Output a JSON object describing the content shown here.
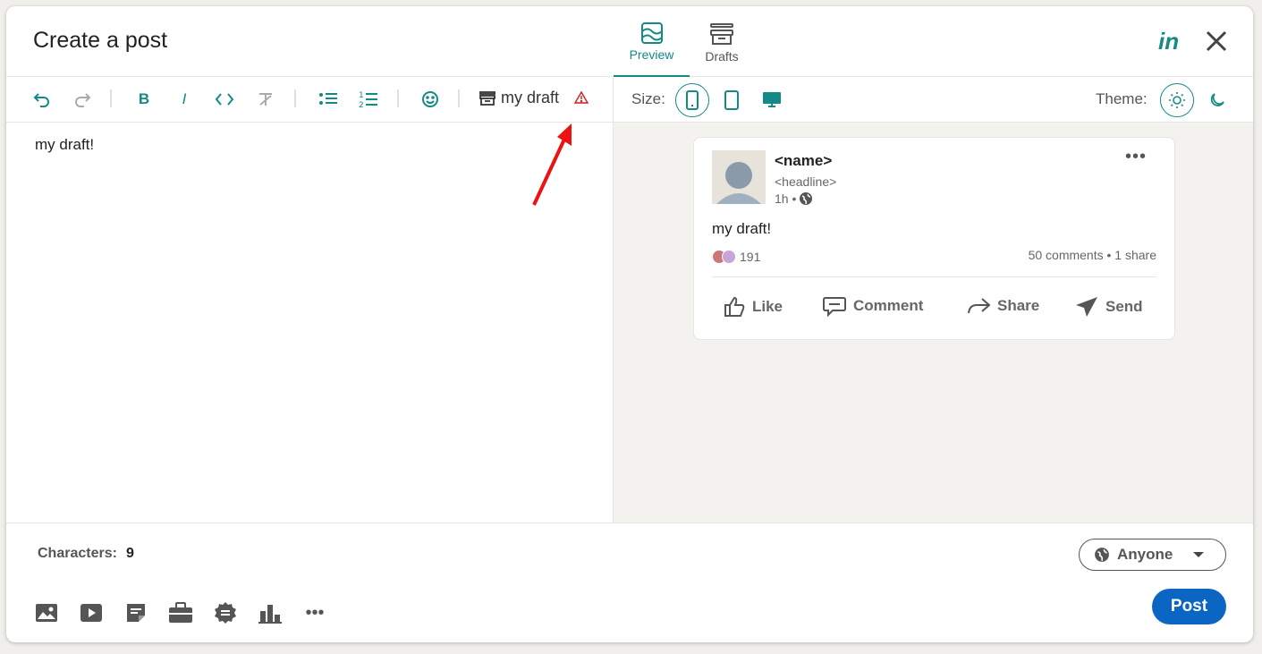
{
  "header": {
    "title": "Create a post",
    "tabs": [
      {
        "label": "Preview",
        "icon": "preview-icon",
        "active": true
      },
      {
        "label": "Drafts",
        "icon": "drafts-icon",
        "active": false
      }
    ],
    "logo": "in"
  },
  "toolbar": {
    "buttons": [
      "undo",
      "redo",
      "bold",
      "italic",
      "code",
      "clear-format",
      "bullet-list",
      "numbered-list",
      "emoji"
    ],
    "draft_name": "my draft",
    "warning": "warning-icon"
  },
  "editor": {
    "text": "my draft!"
  },
  "preview_toolbar": {
    "size_label": "Size:",
    "sizes": [
      "mobile",
      "tablet",
      "desktop"
    ],
    "active_size": "mobile",
    "theme_label": "Theme:",
    "themes": [
      "light",
      "dark"
    ],
    "active_theme": "light"
  },
  "post": {
    "name": "<name>",
    "headline": "<headline>",
    "time": "1h •",
    "body": "my draft!",
    "reaction_count": "191",
    "stats": "50 comments • 1 share",
    "actions": [
      {
        "label": "Like",
        "icon": "like-icon"
      },
      {
        "label": "Comment",
        "icon": "comment-icon"
      },
      {
        "label": "Share",
        "icon": "share-icon"
      },
      {
        "label": "Send",
        "icon": "send-icon"
      }
    ]
  },
  "footer": {
    "characters_label": "Characters:",
    "characters_count": "9",
    "audience": "Anyone",
    "post_label": "Post",
    "attachments": [
      "image",
      "video",
      "document",
      "job",
      "celebrate",
      "poll",
      "more"
    ]
  },
  "colors": {
    "accent": "#138a86",
    "primary": "#0a66c2",
    "warning": "#d11a1a"
  }
}
